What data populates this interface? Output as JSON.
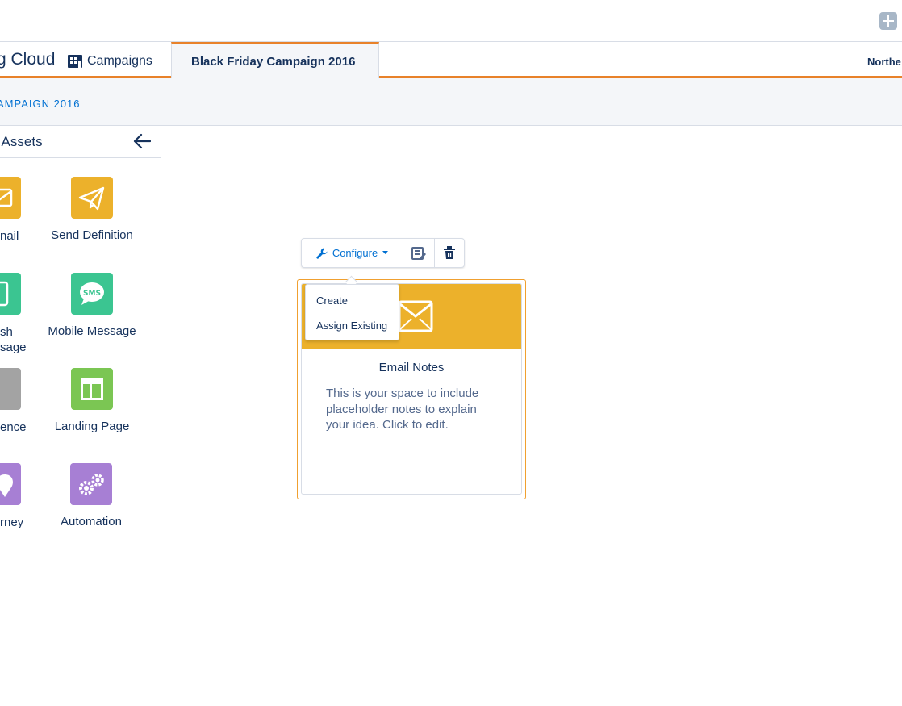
{
  "topbar": {
    "add_icon": "plus-icon"
  },
  "nav": {
    "app_name": "g Cloud",
    "campaigns_label": "Campaigns",
    "campaigns_icon": "building-icon",
    "active_tab": "Black Friday Campaign 2016",
    "org_name": "Northe",
    "accent_color": "#e8822a"
  },
  "breadcrumb": {
    "text": "AMPAIGN 2016"
  },
  "sidebar": {
    "title": "l Assets",
    "back_icon": "arrow-left-icon",
    "assets": [
      {
        "label": "nail",
        "icon": "email-icon",
        "color": "#ecb12b"
      },
      {
        "label": "Send Definition",
        "icon": "paper-plane-icon",
        "color": "#ecb12b"
      },
      {
        "label_line1": "sh",
        "label_line2": "sage",
        "icon": "mobile-icon",
        "color": "#3bc591"
      },
      {
        "label": "Mobile Message",
        "icon": "sms-icon",
        "color": "#3bc591"
      },
      {
        "label": "ence",
        "icon": "audience-icon",
        "color": "#a3a3a3"
      },
      {
        "label": "Landing Page",
        "icon": "layout-icon",
        "color": "#7bc653"
      },
      {
        "label": "rney",
        "icon": "location-pin-icon",
        "color": "#a77fd4"
      },
      {
        "label": "Automation",
        "icon": "gears-icon",
        "color": "#a77fd4"
      }
    ]
  },
  "toolbar": {
    "configure_label": "Configure",
    "configure_icon": "wrench-icon",
    "edit_icon": "notes-edit-icon",
    "delete_icon": "trash-icon"
  },
  "dropdown": {
    "items": [
      "Create",
      "Assign Existing"
    ]
  },
  "card": {
    "title": "Email Notes",
    "description": "This is your space to include placeholder notes to explain your idea. Click to edit.",
    "header_color": "#ecb12b",
    "icon": "email-icon"
  }
}
